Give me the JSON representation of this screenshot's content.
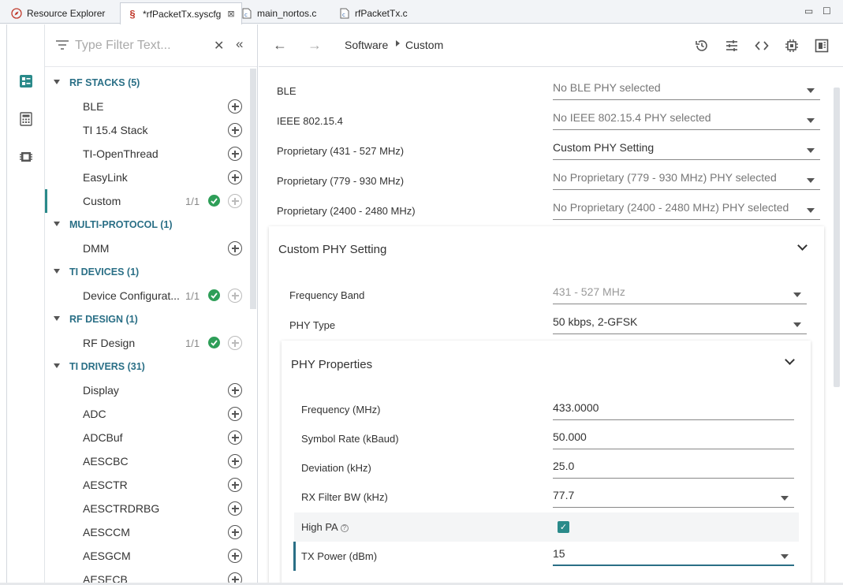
{
  "tabs": [
    {
      "label": "Resource Explorer",
      "icon": "compass-icon",
      "active": false
    },
    {
      "label": "*rfPacketTx.syscfg",
      "icon": "syscfg-icon",
      "active": true
    },
    {
      "label": "main_nortos.c",
      "icon": "c-file-icon",
      "active": false
    },
    {
      "label": "rfPacketTx.c",
      "icon": "c-file-icon",
      "active": false
    }
  ],
  "window": {
    "minimize": "▭",
    "maximize": "☐"
  },
  "filter": {
    "placeholder": "Type Filter Text..."
  },
  "tree": {
    "rf_stacks": {
      "label": "RF STACKS (5)"
    },
    "ble": {
      "label": "BLE"
    },
    "ti154": {
      "label": "TI 15.4 Stack"
    },
    "openthread": {
      "label": "TI-OpenThread"
    },
    "easylink": {
      "label": "EasyLink"
    },
    "custom": {
      "label": "Custom",
      "count": "1/1"
    },
    "multi": {
      "label": "MULTI-PROTOCOL (1)"
    },
    "dmm": {
      "label": "DMM"
    },
    "ti_devices": {
      "label": "TI DEVICES (1)"
    },
    "devcfg": {
      "label": "Device Configurat...",
      "count": "1/1"
    },
    "rf_design": {
      "label": "RF DESIGN (1)"
    },
    "rfdesign": {
      "label": "RF Design",
      "count": "1/1"
    },
    "ti_drivers": {
      "label": "TI DRIVERS (31)"
    },
    "drivers": [
      "Display",
      "ADC",
      "ADCBuf",
      "AESCBC",
      "AESCTR",
      "AESCTRDRBG",
      "AESCCM",
      "AESGCM",
      "AESECB"
    ]
  },
  "breadcrumb": {
    "root": "Software",
    "leaf": "Custom"
  },
  "phy_rows": [
    {
      "label": "BLE",
      "value": "No BLE PHY selected"
    },
    {
      "label": "IEEE 802.15.4",
      "value": "No IEEE 802.15.4 PHY selected"
    },
    {
      "label": "Proprietary (431 - 527 MHz)",
      "value": "Custom PHY Setting"
    },
    {
      "label": "Proprietary (779 - 930 MHz)",
      "value": "No Proprietary (779 - 930 MHz) PHY selected"
    },
    {
      "label": "Proprietary (2400 - 2480 MHz)",
      "value": "No Proprietary (2400 - 2480 MHz) PHY selected"
    }
  ],
  "custom_card": {
    "title": "Custom PHY Setting",
    "freq_band_label": "Frequency Band",
    "freq_band_value": "431 - 527 MHz",
    "phy_type_label": "PHY Type",
    "phy_type_value": "50 kbps, 2-GFSK"
  },
  "phy_props": {
    "title": "PHY Properties",
    "frequency_label": "Frequency (MHz)",
    "frequency_value": "433.0000",
    "symbol_rate_label": "Symbol Rate (kBaud)",
    "symbol_rate_value": "50.000",
    "deviation_label": "Deviation (kHz)",
    "deviation_value": "25.0",
    "rx_bw_label": "RX Filter BW (kHz)",
    "rx_bw_value": "77.7",
    "high_pa_label": "High PA",
    "high_pa_help": "?",
    "high_pa_checked": "✓",
    "tx_power_label": "TX Power (dBm)",
    "tx_power_value": "15"
  },
  "colors": {
    "accent": "#2a8a8a",
    "category": "#2a6f86",
    "check": "#2e9e58"
  }
}
